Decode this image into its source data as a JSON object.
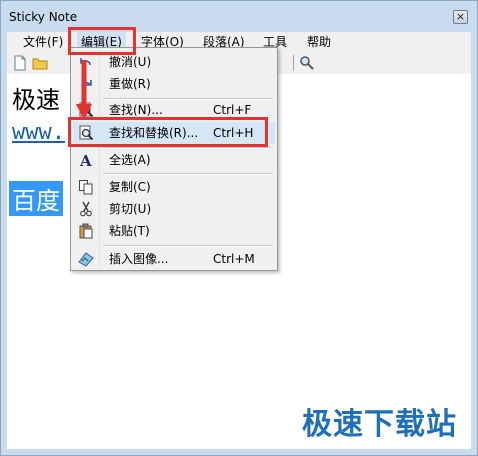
{
  "window": {
    "title": "Sticky Note",
    "close_glyph": "×"
  },
  "menubar": {
    "file": "文件(F)",
    "edit": "编辑(E)",
    "font": "字体(O)",
    "paragraph": "段落(A)",
    "tools": "工具",
    "help": "帮助"
  },
  "editor": {
    "line1": "极速",
    "line2": "www.",
    "line3": "百度"
  },
  "edit_menu": {
    "undo": {
      "label": "撤消(U)"
    },
    "redo": {
      "label": "重做(R)"
    },
    "find": {
      "label": "查找(N)...",
      "shortcut": "Ctrl+F"
    },
    "find_replace": {
      "label": "查找和替换(R)...",
      "shortcut": "Ctrl+H"
    },
    "select_all": {
      "label": "全选(A)"
    },
    "copy": {
      "label": "复制(C)"
    },
    "cut": {
      "label": "剪切(U)"
    },
    "paste": {
      "label": "粘贴(T)"
    },
    "insert_image": {
      "label": "插入图像...",
      "shortcut": "Ctrl+M"
    }
  },
  "watermark": "极速下载站",
  "colors": {
    "highlight": "#d5e6f7",
    "annotation": "#e33232",
    "selection": "#3399ff"
  }
}
